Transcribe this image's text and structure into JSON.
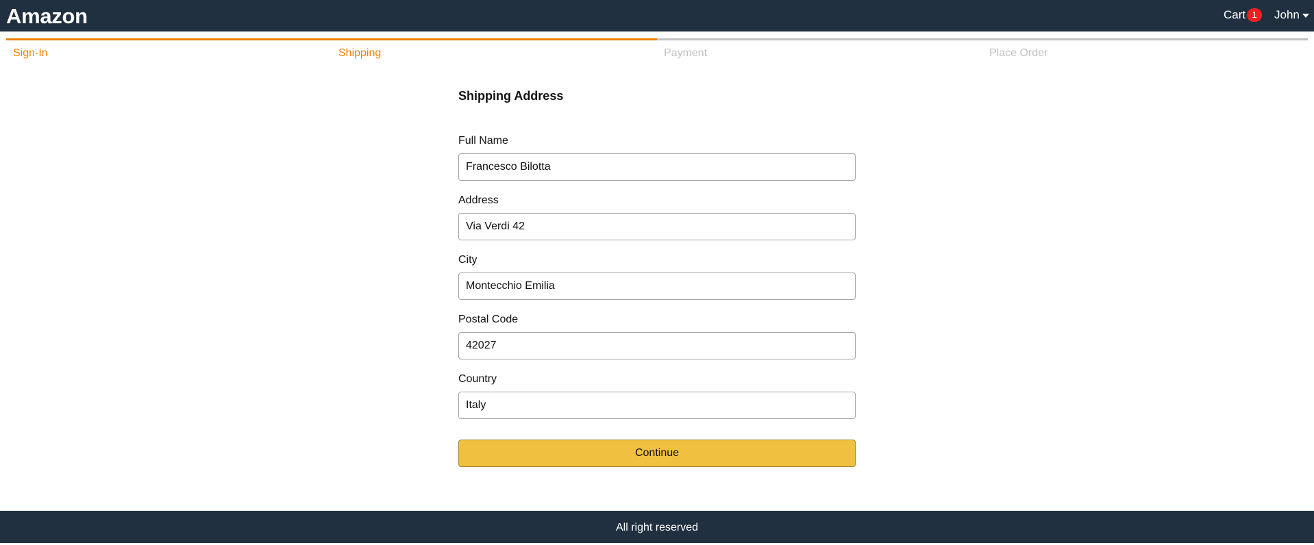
{
  "header": {
    "brand": "Amazon",
    "cart_label": "Cart",
    "cart_count": "1",
    "user_name": "John"
  },
  "steps": [
    {
      "label": "Sign-In",
      "active": true
    },
    {
      "label": "Shipping",
      "active": true
    },
    {
      "label": "Payment",
      "active": false
    },
    {
      "label": "Place Order",
      "active": false
    }
  ],
  "form": {
    "title": "Shipping Address",
    "fields": [
      {
        "label": "Full Name",
        "value": "Francesco Bilotta"
      },
      {
        "label": "Address",
        "value": "Via Verdi 42"
      },
      {
        "label": "City",
        "value": "Montecchio Emilia"
      },
      {
        "label": "Postal Code",
        "value": "42027"
      },
      {
        "label": "Country",
        "value": "Italy"
      }
    ],
    "continue_label": "Continue"
  },
  "footer": {
    "text": "All right reserved"
  },
  "colors": {
    "header_bg": "#203040",
    "accent": "#f08000",
    "inactive": "#c0c0c0",
    "button": "#f0c040",
    "badge": "#f02020"
  }
}
